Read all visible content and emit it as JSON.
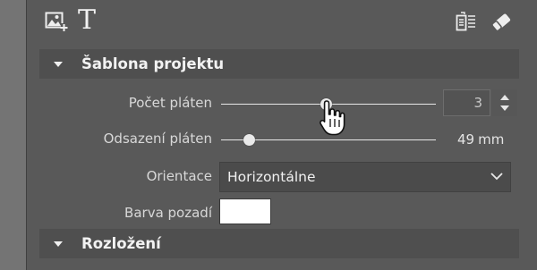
{
  "toolbar": {
    "left_icons": [
      "image-add-icon",
      "text-icon"
    ],
    "right_icons": [
      "copy-layout-icon",
      "eraser-icon"
    ],
    "text_tool_glyph": "T"
  },
  "sections": {
    "project_template": {
      "title": "Šablona projektu",
      "expanded": true
    },
    "layout": {
      "title": "Rozložení",
      "expanded": true
    }
  },
  "fields": {
    "canvas_count": {
      "label": "Počet pláten",
      "value": "3",
      "slider_fraction": 0.49
    },
    "canvas_spacing": {
      "label": "Odsazení pláten",
      "value": "49",
      "unit": "mm",
      "slider_fraction": 0.13
    },
    "orientation": {
      "label": "Orientace",
      "selected": "Horizontálne"
    },
    "background_color": {
      "label": "Barva pozadí",
      "value": "#ffffff"
    }
  },
  "colors": {
    "panel_bg": "#595959",
    "header_bg": "#4f4f4f",
    "gutter_bg": "#747474"
  }
}
